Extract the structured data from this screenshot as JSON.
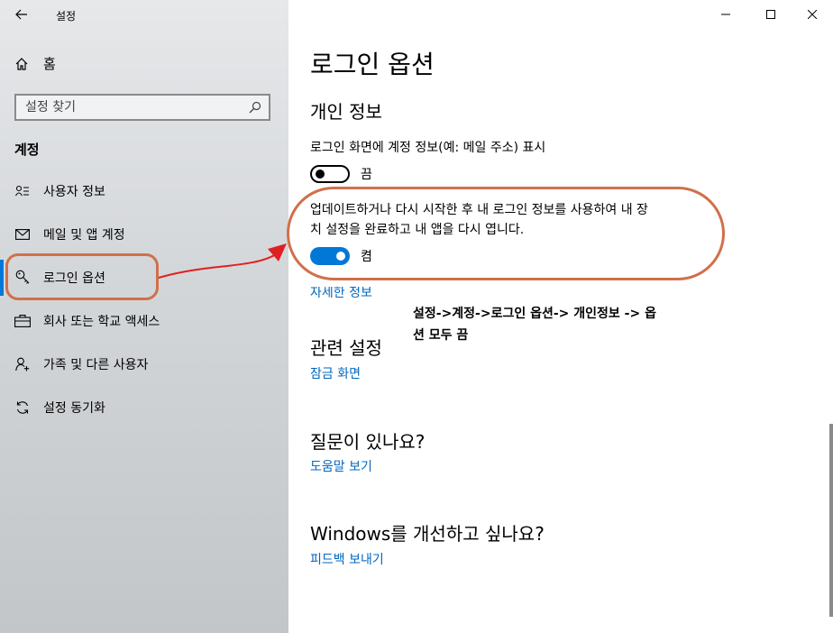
{
  "window": {
    "title": "설정",
    "back_icon": "arrow-left-icon",
    "controls": [
      "minimize-icon",
      "maximize-icon",
      "close-icon"
    ]
  },
  "sidebar": {
    "home_label": "홈",
    "search_placeholder": "설정 찾기",
    "section_label": "계정",
    "items": [
      {
        "label": "사용자 정보",
        "icon": "user-info-icon"
      },
      {
        "label": "메일 및 앱 계정",
        "icon": "mail-icon"
      },
      {
        "label": "로그인 옵션",
        "icon": "key-icon",
        "active": true
      },
      {
        "label": "회사 또는 학교 액세스",
        "icon": "briefcase-icon"
      },
      {
        "label": "가족 및 다른 사용자",
        "icon": "add-person-icon"
      },
      {
        "label": "설정 동기화",
        "icon": "sync-icon"
      }
    ]
  },
  "main": {
    "page_title": "로그인 옵션",
    "privacy_heading": "개인 정보",
    "setting1_desc": "로그인 화면에 계정 정보(예: 메일 주소) 표시",
    "setting1_state": "끔",
    "setting1_on": false,
    "setting2_desc_line1": "업데이트하거나 다시 시작한 후 내 로그인 정보를 사용하여 내 장",
    "setting2_desc_line2": "치 설정을 완료하고 내 앱을 다시 엽니다.",
    "setting2_state": "켬",
    "setting2_on": true,
    "learn_more_link": "자세한 정보",
    "related_heading": "관련 설정",
    "lock_screen_link": "잠금 화면",
    "question_heading": "질문이 있나요?",
    "help_link": "도움말 보기",
    "improve_heading": "Windows를 개선하고 싶나요?",
    "feedback_link": "피드백 보내기"
  },
  "annotation": {
    "line1": "설정->계정->로그인 옵션-> 개인정보 -> 옵",
    "line2": "션 모두 끔"
  },
  "colors": {
    "accent": "#0078d7",
    "link": "#0067c0",
    "callout": "#d0704a",
    "arrow": "#e02020"
  }
}
